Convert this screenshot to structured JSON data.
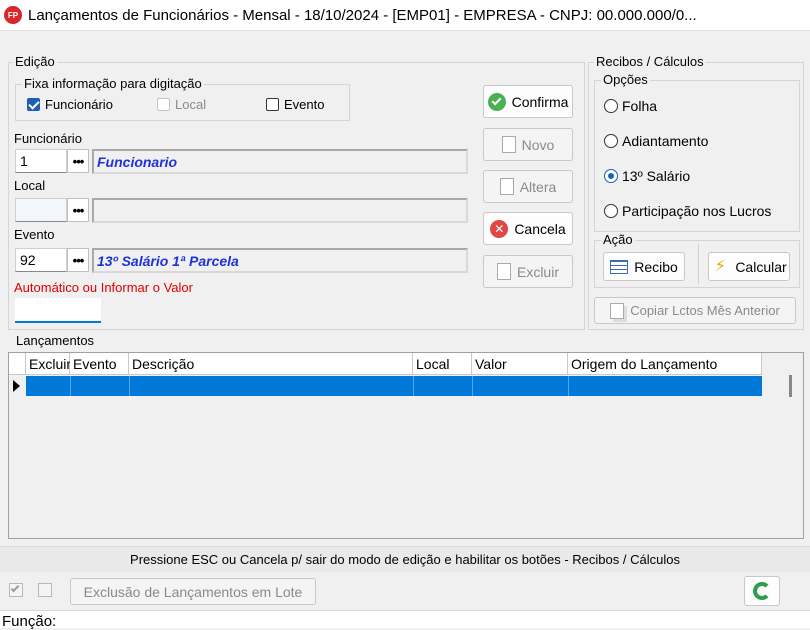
{
  "window": {
    "title": "Lançamentos de Funcionários - Mensal -  18/10/2024 - [EMP01] - EMPRESA - CNPJ: 00.000.000/0...",
    "icon_text": "FP"
  },
  "edicao": {
    "group_label": "Edição",
    "fixa": {
      "label": "Fixa informação para digitação",
      "funcionario": {
        "label": "Funcionário",
        "checked": true
      },
      "local": {
        "label": "Local",
        "checked": false,
        "disabled": true
      },
      "evento": {
        "label": "Evento",
        "checked": false
      }
    },
    "funcionario": {
      "label": "Funcionário",
      "code": "1",
      "description": "Funcionario"
    },
    "local": {
      "label": "Local",
      "code": "",
      "description": ""
    },
    "evento": {
      "label": "Evento",
      "code": "92",
      "description": "13º Salário 1ª Parcela"
    },
    "valor_label": "Automático ou Informar o Valor",
    "valor": "",
    "ellipsis": "•••"
  },
  "actions": {
    "confirma": "Confirma",
    "novo": "Novo",
    "altera": "Altera",
    "cancela": "Cancela",
    "excluir": "Excluir"
  },
  "recibos": {
    "group_label": "Recibos / Cálculos",
    "opcoes_label": "Opções",
    "options": [
      {
        "label": "Folha",
        "selected": false
      },
      {
        "label": "Adiantamento",
        "selected": false
      },
      {
        "label": "13º Salário",
        "selected": true
      },
      {
        "label": "Participação nos Lucros",
        "selected": false
      }
    ],
    "acao_label": "Ação",
    "recibo": "Recibo",
    "calcular": "Calcular",
    "copiar": "Copiar Lctos Mês Anterior"
  },
  "lancamentos": {
    "group_label": "Lançamentos",
    "columns": [
      "Excluir",
      "Evento",
      "Descrição",
      "Local",
      "Valor",
      "Origem do Lançamento"
    ]
  },
  "status": "Pressione ESC ou Cancela p/ sair do modo de edição e habilitar os botões - Recibos / Cálculos",
  "bottom": {
    "exclusao_lote": "Exclusão de Lançamentos em Lote",
    "funcao_label": "Função:"
  },
  "colors": {
    "accent": "#0078d7",
    "desc_text": "#1e32d8",
    "warn_text": "#e00000"
  }
}
